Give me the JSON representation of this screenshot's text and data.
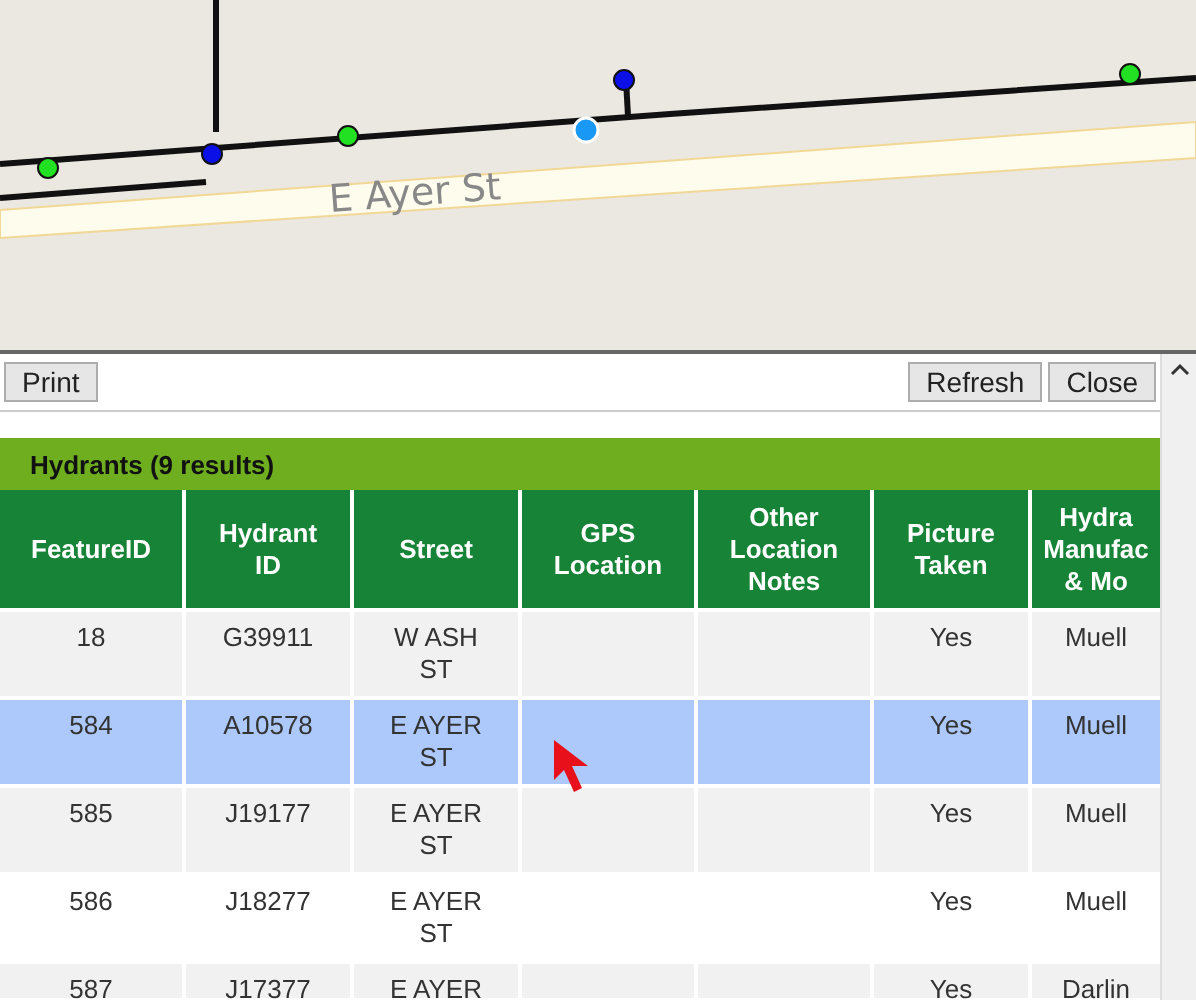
{
  "map": {
    "street_label": "E Ayer St"
  },
  "toolbar": {
    "left_buttons": [
      "Print"
    ],
    "right_buttons": [
      "Refresh",
      "Close"
    ]
  },
  "results": {
    "title": "Hydrants (9 results)",
    "columns": [
      "FeatureID",
      "Hydrant ID",
      "Street",
      "GPS Location",
      "Other Location Notes",
      "Picture Taken",
      "Hydra Manufac & Mo"
    ],
    "rows": [
      {
        "selected": false,
        "cells": [
          "18",
          "G39911",
          "W ASH ST",
          "",
          "",
          "Yes",
          "Muell"
        ]
      },
      {
        "selected": true,
        "cells": [
          "584",
          "A10578",
          "E AYER ST",
          "",
          "",
          "Yes",
          "Muell"
        ]
      },
      {
        "selected": false,
        "cells": [
          "585",
          "J19177",
          "E AYER ST",
          "",
          "",
          "Yes",
          "Muell"
        ]
      },
      {
        "selected": false,
        "cells": [
          "586",
          "J18277",
          "E AYER ST",
          "",
          "",
          "Yes",
          "Muell"
        ]
      },
      {
        "selected": false,
        "cells": [
          "587",
          "J17377",
          "E AYER",
          "",
          "",
          "Yes",
          "Darlin"
        ]
      }
    ]
  }
}
